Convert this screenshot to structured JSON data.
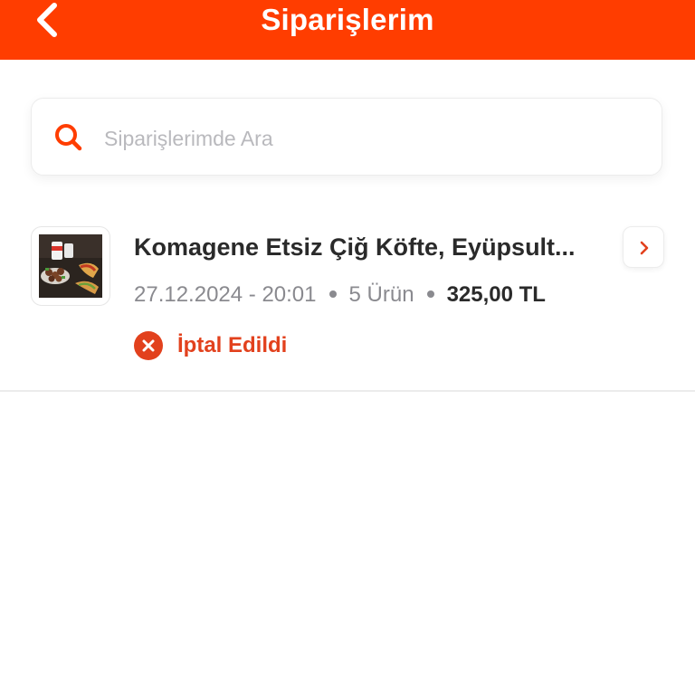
{
  "header": {
    "title": "Siparişlerim",
    "back_icon": "chevron-left-icon",
    "background_color": "#ff3d00"
  },
  "search": {
    "placeholder": "Siparişlerimde Ara",
    "value": "",
    "icon": "search-icon"
  },
  "orders": [
    {
      "store_name": "Komagene Etsiz Çiğ Köfte, Eyüpsult...",
      "date_time": "27.12.2024 - 20:01",
      "item_count": "5 Ürün",
      "total": "325,00 TL",
      "status": "İptal Edildi",
      "status_icon": "close-circle-icon",
      "status_color": "#e2411d",
      "detail_icon": "chevron-right-icon"
    }
  ]
}
